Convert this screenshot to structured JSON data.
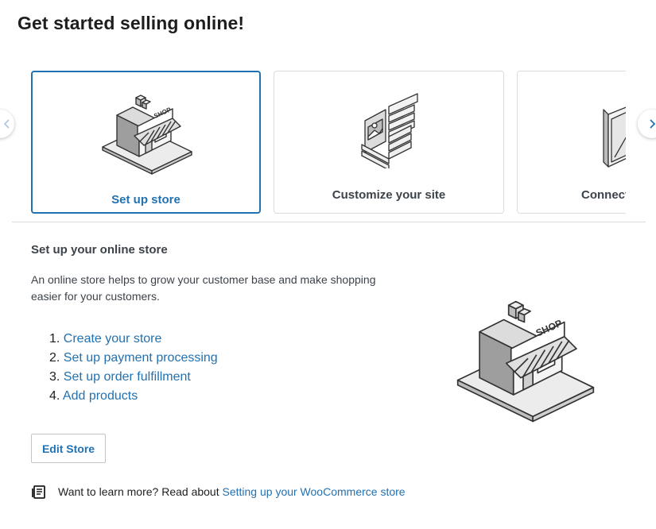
{
  "page": {
    "title": "Get started selling online!"
  },
  "carousel": {
    "cards": [
      {
        "label": "Set up store",
        "selected": true
      },
      {
        "label": "Customize your site",
        "selected": false
      },
      {
        "label": "Connect",
        "selected": false
      }
    ],
    "prev_icon": "chevron-left-icon",
    "next_icon": "chevron-right-icon"
  },
  "section": {
    "title": "Set up your online store",
    "description": "An online store helps to grow your customer base and make shopping easier for your customers.",
    "steps": [
      {
        "number": "1.",
        "label": "Create your store"
      },
      {
        "number": "2.",
        "label": "Set up payment processing"
      },
      {
        "number": "3.",
        "label": "Set up order fulfillment"
      },
      {
        "number": "4.",
        "label": "Add products"
      }
    ],
    "edit_button": "Edit Store",
    "learn_more": {
      "icon": "book-icon",
      "prefix": "Want to learn more? Read about ",
      "link": "Setting up your WooCommerce store"
    },
    "illustration_sign": "SHOP"
  },
  "colors": {
    "accent": "#2271b1",
    "text": "#1e1e1e",
    "muted": "#3c434a",
    "border": "#dcdcde"
  }
}
